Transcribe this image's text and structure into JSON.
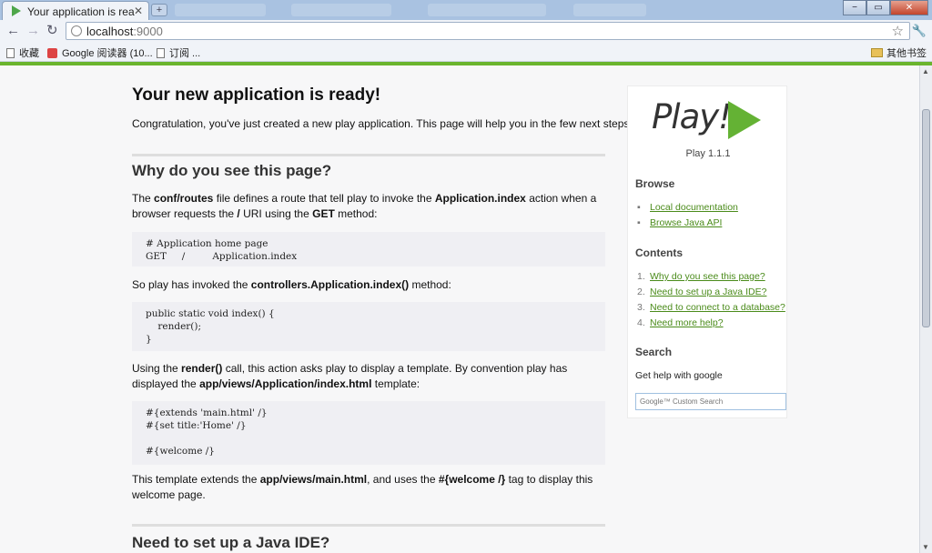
{
  "browser": {
    "tab_title": "Your application is rea...",
    "close_tab": "✕",
    "new_tab": "+",
    "url_host": "localhost",
    "url_port": ":9000",
    "bookmarks": [
      "收藏",
      "Google 阅读器 (10...",
      "订阅 ..."
    ],
    "other_bookmarks": "其他书签",
    "window_buttons": [
      "−",
      "▭",
      "✕"
    ]
  },
  "page": {
    "title": "Your new application is ready!",
    "intro": "Congratulation, you've just created a new play application. This page will help you in the few next steps.",
    "sections": [
      {
        "heading": "Why do you see this page?"
      },
      {
        "heading": "Need to set up a Java IDE?"
      }
    ],
    "para1": {
      "t1": "The ",
      "b1": "conf/routes",
      "t2": " file defines a route that tell play to invoke the ",
      "b2": "Application.index",
      "t3": " action when a browser requests the ",
      "b3": "/",
      "t4": " URI using the ",
      "b4": "GET",
      "t5": " method:"
    },
    "code1": "# Application home page\nGET     /         Application.index",
    "para2": {
      "t1": "So play has invoked the ",
      "b1": "controllers.Application.index()",
      "t2": " method:"
    },
    "code2": "public static void index() {\n    render();\n}",
    "para3": {
      "t1": "Using the ",
      "b1": "render()",
      "t2": " call, this action asks play to display a template. By convention play has displayed the ",
      "b2": "app/views/Application/index.html",
      "t3": " template:"
    },
    "code3": "#{extends 'main.html' /}\n#{set title:'Home' /}\n\n#{welcome /}",
    "para4": {
      "t1": "This template extends the ",
      "b1": "app/views/main.html",
      "t2": ", and uses the ",
      "b2": "#{welcome /}",
      "t3": " tag to display this welcome page."
    }
  },
  "sidebar": {
    "logo_text": "Play!",
    "version": "Play 1.1.1",
    "browse_heading": "Browse",
    "browse_links": [
      "Local documentation",
      "Browse Java API"
    ],
    "contents_heading": "Contents",
    "contents": [
      "Why do you see this page?",
      "Need to set up a Java IDE?",
      "Need to connect to a database?",
      "Need more help?"
    ],
    "search_heading": "Search",
    "search_text": "Get help with google",
    "search_placeholder": "Google™ Custom Search"
  },
  "colors": {
    "play_green": "#64b234",
    "link_green": "#4a8b1a",
    "accent_bar": "#6ab42d"
  }
}
